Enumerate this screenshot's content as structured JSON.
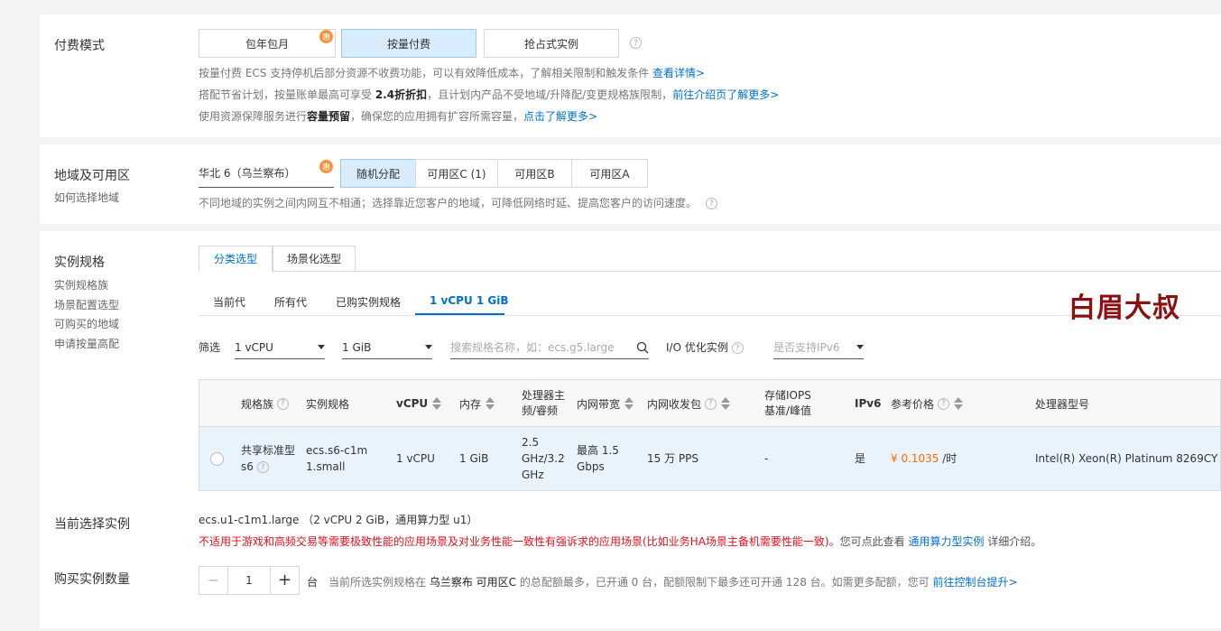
{
  "billing": {
    "label": "付费模式",
    "options": [
      "包年包月",
      "按量付费",
      "抢占式实例"
    ],
    "badge": "惠",
    "selected": 1,
    "line1_text": "按量付费 ECS 支持停机后部分资源不收费功能，可以有效降低成本，了解相关限制和触发条件 ",
    "line1_link": "查看详情>",
    "line2_pre": "搭配节省计划，按量账单最高可享受 ",
    "line2_bold": "2.4折折扣",
    "line2_mid": "，且计划内产品不受地域/升降配/变更规格族限制，",
    "line2_link": "前往介绍页了解更多>",
    "line3_pre": "使用资源保障服务进行",
    "line3_bold": "容量预留",
    "line3_mid": "，确保您的应用拥有扩容所需容量，",
    "line3_link": "点击了解更多>"
  },
  "region": {
    "label": "地域及可用区",
    "sublabel": "如何选择地域",
    "region_value": "华北 6（乌兰察布）",
    "badge": "惠",
    "zones": [
      "随机分配",
      "可用区C (1)",
      "可用区B",
      "可用区A"
    ],
    "selected": 0,
    "note": "不同地域的实例之间内网互不相通；选择靠近您客户的地域，可降低网络时延、提高您客户的访问速度。"
  },
  "spec": {
    "label": "实例规格",
    "links": [
      "实例规格族",
      "场景配置选型",
      "可购买的地域",
      "申请按量高配"
    ],
    "tabs": [
      "分类选型",
      "场景化选型"
    ],
    "subtabs": [
      "当前代",
      "所有代",
      "已购实例规格",
      "1 vCPU 1 GiB"
    ],
    "watermark": "白眉大叔",
    "filter_label": "筛选",
    "cpu_value": "1 vCPU",
    "mem_value": "1 GiB",
    "search_placeholder": "搜索规格名称，如：ecs.g5.large",
    "io_label": "I/O 优化实例",
    "ipv6_placeholder": "是否支持IPv6",
    "columns": [
      "规格族",
      "实例规格",
      "vCPU",
      "内存",
      "处理器主频/睿频",
      "内网带宽",
      "内网收发包",
      "存储IOPS 基准/峰值",
      "IPv6",
      "参考价格",
      "处理器型号"
    ],
    "row": {
      "family": "共享标准型 s6",
      "spec": "ecs.s6-c1m1.small",
      "vcpu": "1 vCPU",
      "mem": "1 GiB",
      "freq": "2.5 GHz/3.2 GHz",
      "bandwidth": "最高 1.5 Gbps",
      "pps": "15 万 PPS",
      "iops": "-",
      "ipv6": "是",
      "price": "¥ 0.1035",
      "price_unit": " /时",
      "cpu_model": "Intel(R) Xeon(R) Platinum 8269CY"
    }
  },
  "current": {
    "label": "当前选择实例",
    "value": "ecs.u1-c1m1.large （2 vCPU 2 GiB，通用算力型 u1）",
    "warn": "不适用于游戏和高频交易等需要极致性能的应用场景及对业务性能一致性有强诉求的应用场景(比如业务HA场景主备机需要性能一致)。",
    "warn_tail": "您可点此查看 ",
    "warn_link": "通用算力型实例",
    "warn_end": " 详细介绍。"
  },
  "quantity": {
    "label": "购买实例数量",
    "value": "1",
    "unit": "台",
    "note_pre": "当前所选实例规格在 ",
    "note_bold": "乌兰察布 可用区C",
    "note_mid": " 的总配额最多，已开通 0 台，配额限制下最多还可开通 128 台。如需更多配额，您可 ",
    "note_link": "前往控制台提升>"
  },
  "colors": {
    "accent": "#0070cc",
    "selected_bg": "#d9ecfb",
    "badge": "#f5923b",
    "warn": "#e0101e",
    "price": "#ff6a00",
    "watermark": "#8b1010"
  }
}
